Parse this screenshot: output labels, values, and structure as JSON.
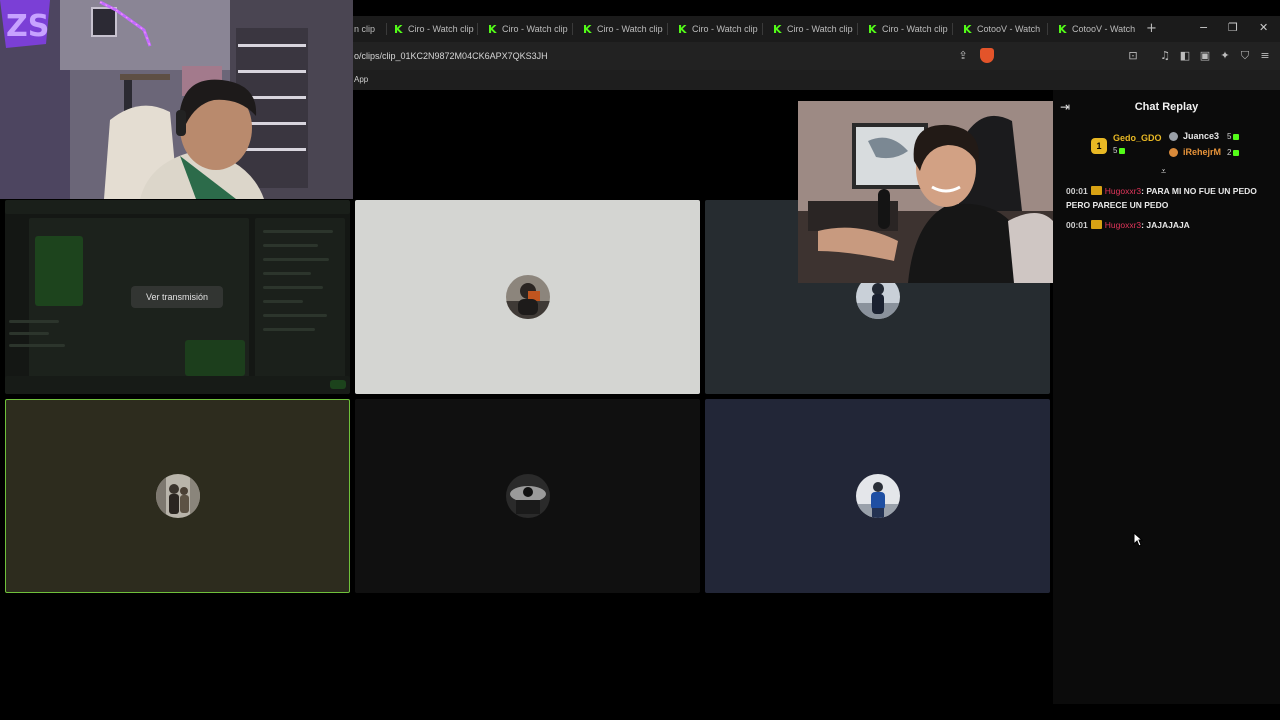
{
  "browser": {
    "tabs": [
      {
        "title": "Ciro - Watch clip"
      },
      {
        "title": "Ciro - Watch clip"
      },
      {
        "title": "Ciro - Watch clip"
      },
      {
        "title": "Ciro - Watch clip"
      },
      {
        "title": "Ciro - Watch clip"
      },
      {
        "title": "Ciro - Watch clip"
      },
      {
        "title": "CotooV - Watch"
      },
      {
        "title": "CotooV - Watch"
      }
    ],
    "new_tab": "+",
    "url": "o/clips/clip_01KC2N9872M04CK6APX7QKS3JH",
    "bookmark": "App",
    "accent_color": "#53fc18"
  },
  "stage": {
    "watch_stream_label": "Ver transmisión",
    "active_tile_border": "#6fc13b"
  },
  "chat": {
    "title": "Chat Replay",
    "top_gifters": [
      {
        "name": "Gedo_GDO",
        "count": "5",
        "rank": "1"
      },
      {
        "name": "Juance3",
        "count": "5"
      },
      {
        "name": "iRehejrM",
        "count": "2"
      }
    ],
    "messages": [
      {
        "time": "00:01",
        "user": "Hugoxxr3",
        "separator": ":",
        "text": "PARA MI NO FUE UN PEDO PERO PARECE UN PEDO"
      },
      {
        "time": "00:01",
        "user": "Hugoxxr3",
        "separator": ":",
        "text": "JAJAJAJA"
      }
    ]
  }
}
